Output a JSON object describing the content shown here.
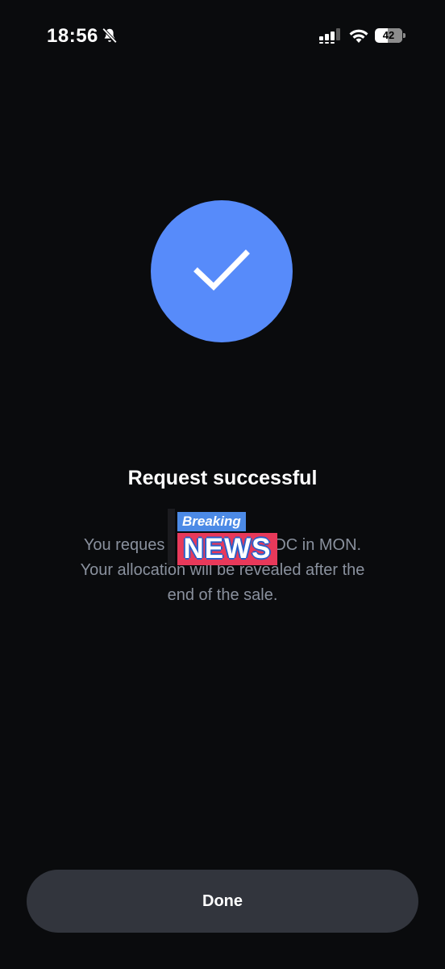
{
  "status_bar": {
    "time": "18:56",
    "battery_level": "42",
    "icons": [
      "bell-slash-icon",
      "cellular-signal-icon",
      "wifi-icon",
      "battery-icon"
    ]
  },
  "success": {
    "icon": "checkmark-icon",
    "title": "Request successful",
    "message_line_1": "You reques",
    "message_line_1_end": "DC in MON.",
    "message_line_2": "Your allocation will be revealed after the",
    "message_line_3": "end of the sale."
  },
  "news_overlay": {
    "label_small": "Breaking",
    "label_large": "NEWS"
  },
  "done_button": {
    "label": "Done"
  },
  "colors": {
    "background": "#0a0b0d",
    "accent": "#578bfa",
    "button_bg": "#32353d",
    "muted_text": "#8a919e",
    "news_red": "#e8395a",
    "news_blue": "#4c8ae6"
  }
}
